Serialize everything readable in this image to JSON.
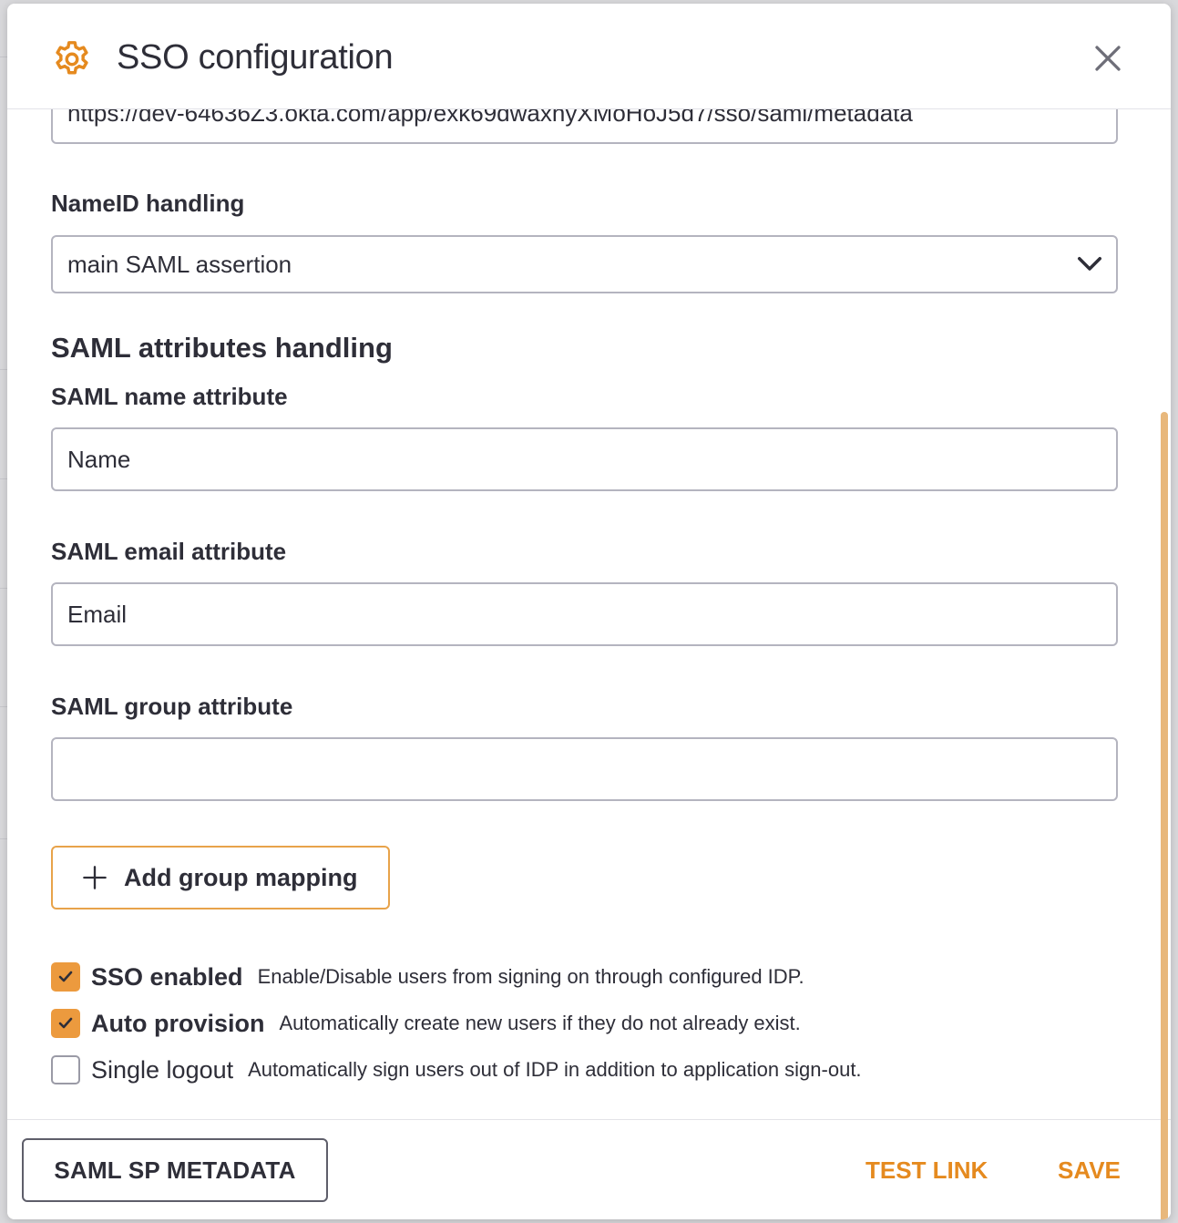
{
  "dialog": {
    "title": "SSO configuration",
    "metadata_url_value": "https://dev-64636Z3.okta.com/app/exk69dwaxhyXMoHoJ5d7/sso/saml/metadata"
  },
  "nameid": {
    "label": "NameID handling",
    "selected": "main SAML assertion"
  },
  "attributes": {
    "section_title": "SAML attributes handling",
    "name_label": "SAML name attribute",
    "name_value": "Name",
    "email_label": "SAML email attribute",
    "email_value": "Email",
    "group_label": "SAML group attribute",
    "group_value": ""
  },
  "add_group_mapping_label": "Add group mapping",
  "options": [
    {
      "title": "SSO enabled",
      "description": "Enable/Disable users from signing on through configured IDP.",
      "checked": true
    },
    {
      "title": "Auto provision",
      "description": "Automatically create new users if they do not already exist.",
      "checked": true
    },
    {
      "title": "Single logout",
      "description": "Automatically sign users out of IDP in addition to application sign-out.",
      "checked": false
    }
  ],
  "footer": {
    "metadata_button": "SAML SP METADATA",
    "test_link": "TEST LINK",
    "save": "SAVE"
  },
  "colors": {
    "accent": "#ec9a3e",
    "accent_text": "#e58a1f",
    "scrollbar": "#e8b87c"
  },
  "icons": {
    "header": "gear-icon",
    "close": "close-icon",
    "select": "chevron-down-icon",
    "add": "plus-icon",
    "check": "check-icon"
  }
}
